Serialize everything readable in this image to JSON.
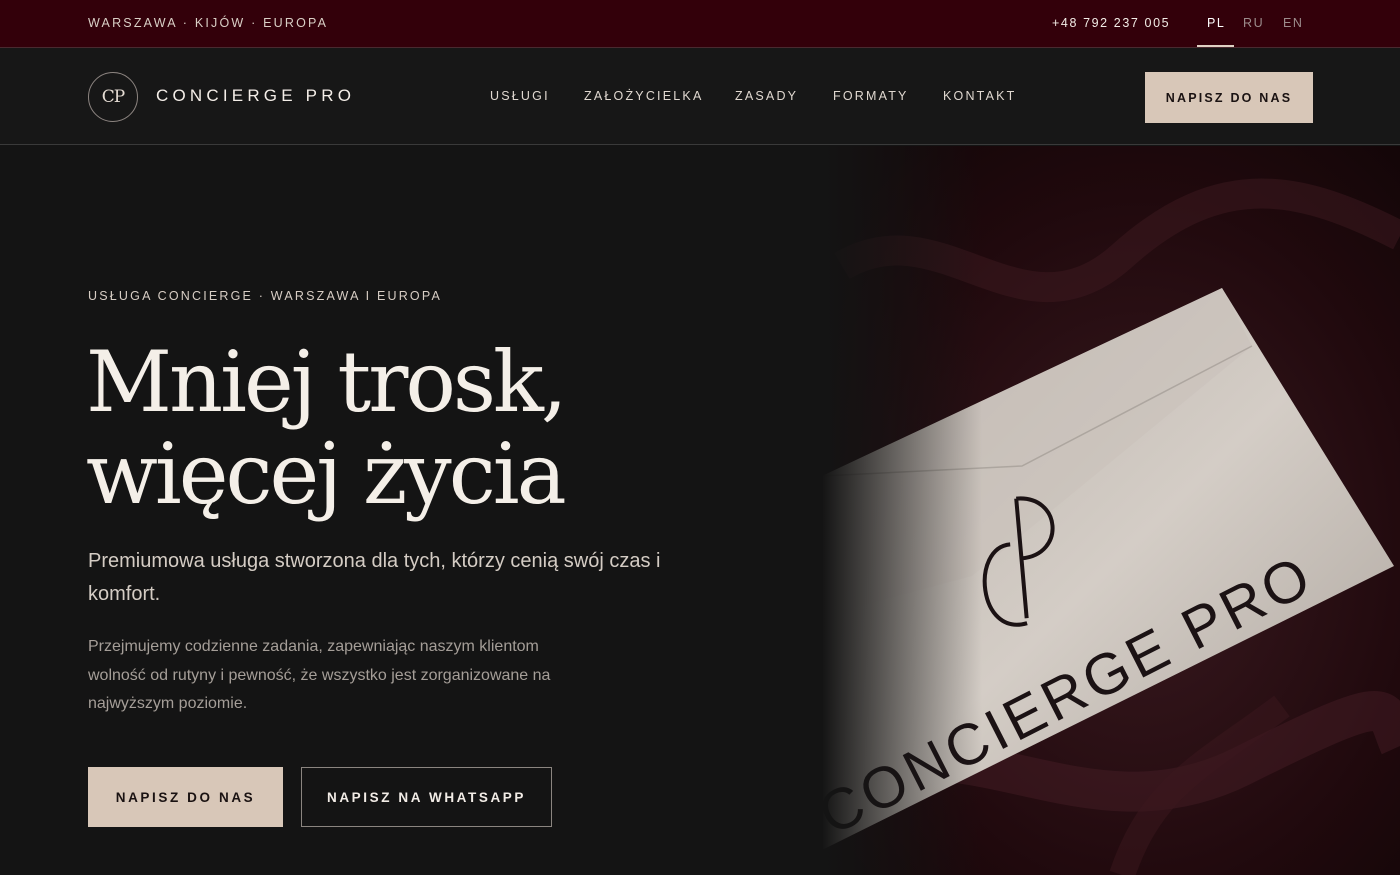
{
  "topbar": {
    "locations": "WARSZAWA · KIJÓW · EUROPA",
    "phone": "+48 792 237 005",
    "languages": [
      "PL",
      "RU",
      "EN"
    ],
    "active_language": "PL"
  },
  "header": {
    "logo_mark": "CP",
    "brand_name": "CONCIERGE PRO",
    "nav": [
      "USŁUGI",
      "ZAŁOŻYCIELKA",
      "ZASADY",
      "FORMATY",
      "KONTAKT"
    ],
    "cta_label": "NAPISZ DO NAS"
  },
  "hero": {
    "eyebrow": "USŁUGA CONCIERGE · WARSZAWA I EUROPA",
    "headline_line1": "Mniej trosk,",
    "headline_line2": "więcej życia",
    "lead": "Premiumowa usługa stworzona dla tych, którzy cenią swój czas i komfort.",
    "body": "Przejmujemy codzienne zadania, zapewniając naszym klientom wolność od rutyny i pewność, że wszystko jest zorganizowane na najwyższym poziomie.",
    "primary_button": "NAPISZ DO NAS",
    "secondary_button": "NAPISZ NA WHATSAPP",
    "image": {
      "envelope_monogram": "CP",
      "envelope_wordmark": "CONCIERGE PRO"
    }
  },
  "colors": {
    "topbar_bg": "#33000a",
    "header_bg": "#171717",
    "page_bg": "#141414",
    "accent_beige": "#d8c7b8",
    "text_light": "#f4efe8"
  }
}
